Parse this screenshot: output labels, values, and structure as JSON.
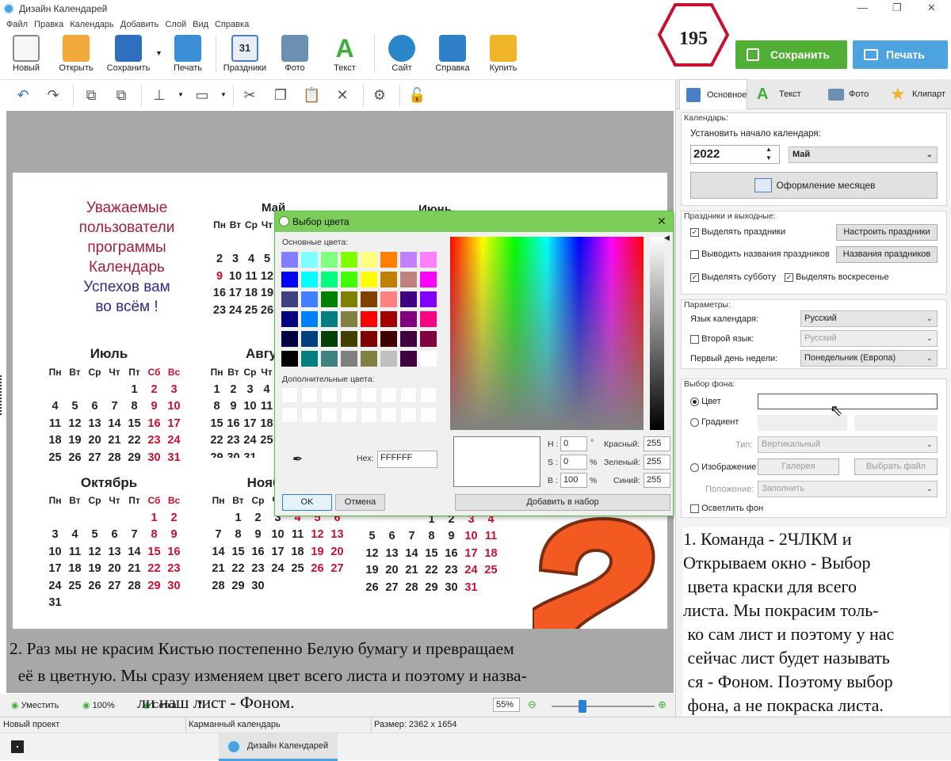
{
  "window": {
    "title": "Дизайн Календарей",
    "min": "—",
    "max": "❐",
    "close": "✕"
  },
  "menu": [
    "Файл",
    "Правка",
    "Календарь",
    "Добавить",
    "Слой",
    "Вид",
    "Справка"
  ],
  "toolbar": [
    {
      "label": "Новый",
      "icon": "new-file-icon",
      "color": "#f3f3f3"
    },
    {
      "label": "Открыть",
      "icon": "folder-icon",
      "color": "#f2a83a"
    },
    {
      "label": "Сохранить",
      "icon": "floppy-icon",
      "color": "#2f6fc0"
    },
    {
      "label": "Печать",
      "icon": "printer-icon",
      "color": "#3a8fd4"
    },
    {
      "label": "Праздники",
      "icon": "calendar-icon",
      "color": "#4a7ec8"
    },
    {
      "label": "Фото",
      "icon": "camera-icon",
      "color": "#6c8fb2"
    },
    {
      "label": "Текст",
      "icon": "text-icon",
      "color": "#3fae3a"
    },
    {
      "label": "Сайт",
      "icon": "globe-icon",
      "color": "#2a86c8"
    },
    {
      "label": "Справка",
      "icon": "book-icon",
      "color": "#2f7fc9"
    },
    {
      "label": "Купить",
      "icon": "bag-icon",
      "color": "#f0b429"
    }
  ],
  "badge": "195",
  "save_button": "Сохранить",
  "print_button": "Печать",
  "canvas": {
    "wish": [
      "Уважаемые",
      "пользователи",
      "программы",
      "Календарь",
      "Успехов вам",
      "во всём !"
    ],
    "weekdays": [
      "Пн",
      "Вт",
      "Ср",
      "Чт",
      "Пт",
      "Сб",
      "Вс"
    ],
    "months": {
      "may": "Май",
      "june": "Июнь",
      "july": "Июль",
      "aug": "Авгу",
      "oct": "Октябрь",
      "nov": "Ноябрь"
    }
  },
  "color_dialog": {
    "title": "Выбор цвета",
    "basic_label": "Основные цвета:",
    "custom_label": "Дополнительные цвета:",
    "basic_colors": [
      "#8080ff",
      "#80ffff",
      "#80ff80",
      "#80ff00",
      "#ffff80",
      "#ff8000",
      "#c080ff",
      "#ff80ff",
      "#0000ff",
      "#00ffff",
      "#00ff80",
      "#40ff00",
      "#ffff00",
      "#c08000",
      "#c08080",
      "#ff00ff",
      "#404080",
      "#4080ff",
      "#008000",
      "#808000",
      "#804000",
      "#ff8080",
      "#400080",
      "#8000ff",
      "#000080",
      "#0080ff",
      "#008080",
      "#808040",
      "#ff0000",
      "#a00000",
      "#800080",
      "#ff0080",
      "#000040",
      "#004080",
      "#004000",
      "#404000",
      "#800000",
      "#400000",
      "#400040",
      "#800040",
      "#000000",
      "#008080",
      "#408080",
      "#808080",
      "#808040",
      "#c0c0c0",
      "#400040",
      "#ffffff"
    ],
    "hex_label": "Hex:",
    "hex_value": "FFFFFF",
    "h_label": "H :",
    "h_value": "0",
    "h_unit": "°",
    "s_label": "S :",
    "s_value": "0",
    "s_unit": "%",
    "b_label": "B :",
    "b_value": "100",
    "b_unit": "%",
    "r_label": "Красный:",
    "r_value": "255",
    "g_label": "Зеленый:",
    "g_value": "255",
    "bl_label": "Синий:",
    "bl_value": "255",
    "ok": "OK",
    "cancel": "Отмена",
    "add": "Добавить в набор"
  },
  "panel": {
    "tabs": [
      "Основное",
      "Текст",
      "Фото",
      "Клипарт"
    ],
    "calendar_group": "Календарь:",
    "start_label": "Установить начало календаря:",
    "year": "2022",
    "month": "Май",
    "design_button": "Оформление месяцев",
    "holidays_group": "Праздники и выходные:",
    "cb_holidays": "Выделять праздники",
    "btn_setup": "Настроить праздники",
    "cb_names": "Выводить названия праздников",
    "btn_names": "Названия праздников",
    "cb_sat": "Выделять субботу",
    "cb_sun": "Выделять воскресенье",
    "params_group": "Параметры:",
    "lang_label": "Язык календаря:",
    "lang_value": "Русский",
    "lang2_label": "Второй язык:",
    "lang2_value": "Русский",
    "firstday_label": "Первый день недели:",
    "firstday_value": "Понедельник (Европа)",
    "bg_group": "Выбор фона:",
    "rb_color": "Цвет",
    "rb_gradient": "Градиент",
    "type_label": "Тип:",
    "type_value": "Вертикальный",
    "rb_image": "Изображение",
    "gallery": "Галерея",
    "choose_file": "Выбрать файл",
    "position_label": "Положение:",
    "position_value": "Заполнить",
    "cb_lighten": "Осветлить фон"
  },
  "annotation_right": [
    "1. Команда - 2ЧЛКМ и",
    "Открываем окно - Выбор",
    " цвета краски для всего",
    "листа. Мы покрасим толь-",
    " ко сам лист и поэтому у нас",
    " сейчас лист будет называть",
    " ся - Фоном. Поэтому выбор",
    " фона, а не покраска листа."
  ],
  "annotation_bottom": [
    "2. Раз мы не красим Кистью постепенно Белую бумагу и превращаем",
    "  её в цветную. Мы сразу изменяем цвет всего листа и поэтому и назва-",
    "                              ли наш лист - Фоном."
  ],
  "zoombar": {
    "fit": "Уместить",
    "z100": "100%",
    "grid": "Сетка",
    "zoom": "55%",
    "slider_fraction": 0.3
  },
  "status": {
    "project": "Новый проект",
    "template": "Карманный календарь",
    "size": "Размер: 2362 x 1654"
  },
  "taskbar": {
    "app": "Дизайн Календарей"
  }
}
